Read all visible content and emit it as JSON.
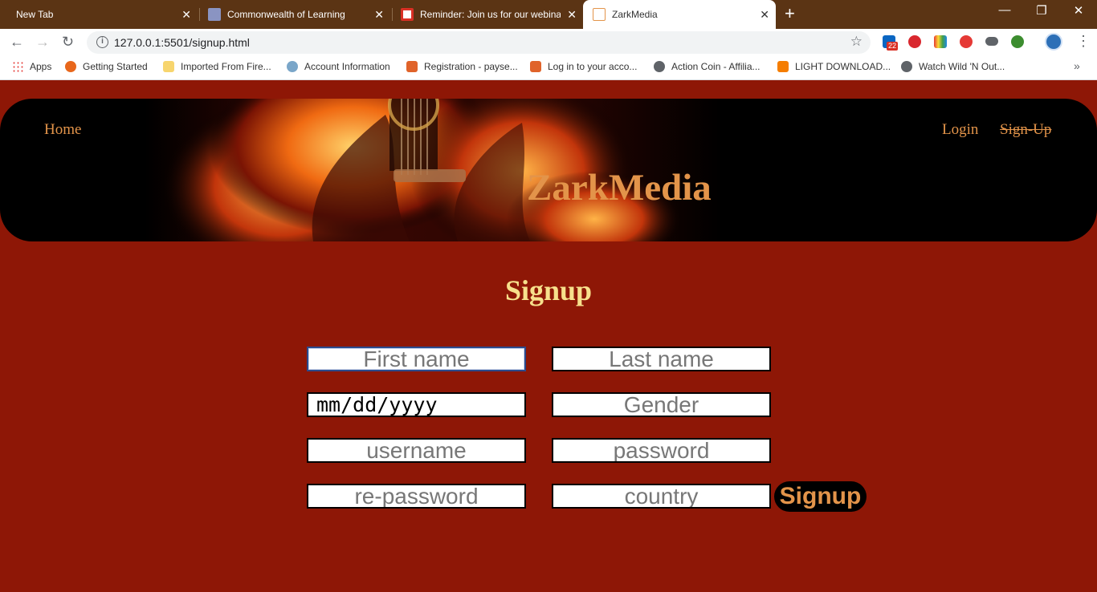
{
  "browser": {
    "tabs": [
      {
        "title": "New Tab",
        "active": false
      },
      {
        "title": "Commonwealth of Learning",
        "active": false
      },
      {
        "title": "Reminder: Join us for our webinar",
        "active": false
      },
      {
        "title": "ZarkMedia",
        "active": true
      }
    ],
    "url": "127.0.0.1:5501/signup.html",
    "extension_badge": "22",
    "bookmarks": [
      {
        "label": "Apps",
        "icon": "apps-grid-icon"
      },
      {
        "label": "Getting Started",
        "icon": "firefox-icon"
      },
      {
        "label": "Imported From Fire...",
        "icon": "folder-icon"
      },
      {
        "label": "Account Information",
        "icon": "account-icon"
      },
      {
        "label": "Registration - payse...",
        "icon": "payse-icon"
      },
      {
        "label": "Log in to your acco...",
        "icon": "payse-icon"
      },
      {
        "label": "Action Coin - Affilia...",
        "icon": "globe-icon"
      },
      {
        "label": "LIGHT DOWNLOAD...",
        "icon": "blogger-icon"
      },
      {
        "label": "Watch Wild 'N Out...",
        "icon": "globe-icon"
      }
    ],
    "more_bookmarks": "»"
  },
  "nav": {
    "home": "Home",
    "login": "Login",
    "signup": "Sign-Up"
  },
  "brand": "ZarkMedia",
  "page_title": "Signup",
  "form": {
    "first_name": "First name",
    "last_name": "Last name",
    "dob": "mm/dd/yyyy",
    "gender": "Gender",
    "username": "username",
    "password": "password",
    "re_password": "re-password",
    "country": "country",
    "submit": "Signup"
  },
  "colors": {
    "page_bg": "#8e1706",
    "accent": "#e3944a",
    "title": "#f7e08c",
    "tabstrip": "#5b3414"
  }
}
